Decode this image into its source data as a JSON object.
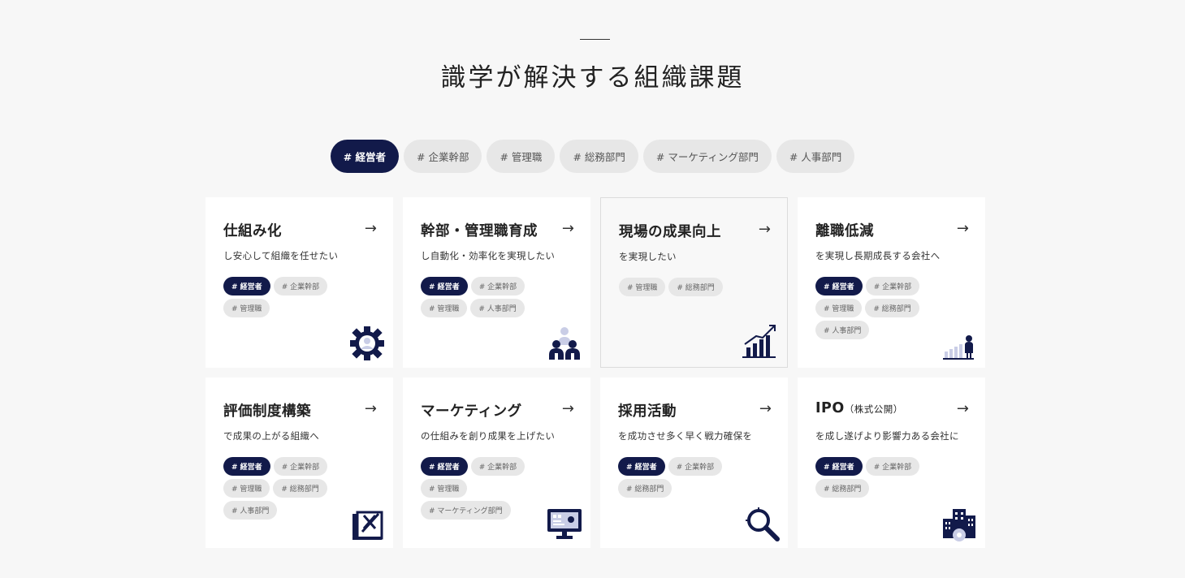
{
  "section": {
    "title": "識学が解決する組織課題"
  },
  "filters": [
    "# 経営者",
    "# 企業幹部",
    "# 管理職",
    "# 総務部門",
    "# マーケティング部門",
    "# 人事部門"
  ],
  "active_filter": "# 経営者",
  "cards": [
    {
      "title": "仕組み化",
      "desc": "し安心して組織を任せたい",
      "arrow": "→",
      "tags": [
        "# 経営者",
        "# 企業幹部",
        "# 管理職"
      ],
      "icon": "gear-person-icon"
    },
    {
      "title": "幹部・管理職育成",
      "desc": "し自動化・効率化を実現したい",
      "arrow": "→",
      "tags": [
        "# 経営者",
        "# 企業幹部",
        "# 管理職",
        "# 人事部門"
      ],
      "icon": "team-icon"
    },
    {
      "title": "現場の成果向上",
      "desc": "を実現したい",
      "arrow": "→",
      "tags": [
        "# 管理職",
        "# 総務部門"
      ],
      "icon": "growth-chart-icon"
    },
    {
      "title": "離職低減",
      "desc": "を実現し長期成長する会社へ",
      "arrow": "→",
      "tags": [
        "# 経営者",
        "# 企業幹部",
        "# 管理職",
        "# 総務部門",
        "# 人事部門"
      ],
      "icon": "person-chart-icon"
    },
    {
      "title": "評価制度構築",
      "desc": "で成果の上がる組織へ",
      "arrow": "→",
      "tags": [
        "# 経営者",
        "# 企業幹部",
        "# 管理職",
        "# 総務部門",
        "# 人事部門"
      ],
      "icon": "evaluation-icon"
    },
    {
      "title": "マーケティング",
      "desc": "の仕組みを創り成果を上げたい",
      "arrow": "→",
      "tags": [
        "# 経営者",
        "# 企業幹部",
        "# 管理職",
        "# マーケティング部門"
      ],
      "icon": "monitor-icon"
    },
    {
      "title": "採用活動",
      "desc": "を成功させ多く早く戦力確保を",
      "arrow": "→",
      "tags": [
        "# 経営者",
        "# 企業幹部",
        "# 総務部門"
      ],
      "icon": "magnifier-icon"
    },
    {
      "title": "IPO",
      "title_small": "（株式公開）",
      "desc": "を成し遂げより影響力ある会社に",
      "arrow": "→",
      "tags": [
        "# 経営者",
        "# 企業幹部",
        "# 総務部門"
      ],
      "icon": "buildings-icon"
    }
  ],
  "colors": {
    "accent": "#121a4a",
    "tag_bg": "#e7e7e7",
    "page_bg": "#f7f7f7"
  }
}
